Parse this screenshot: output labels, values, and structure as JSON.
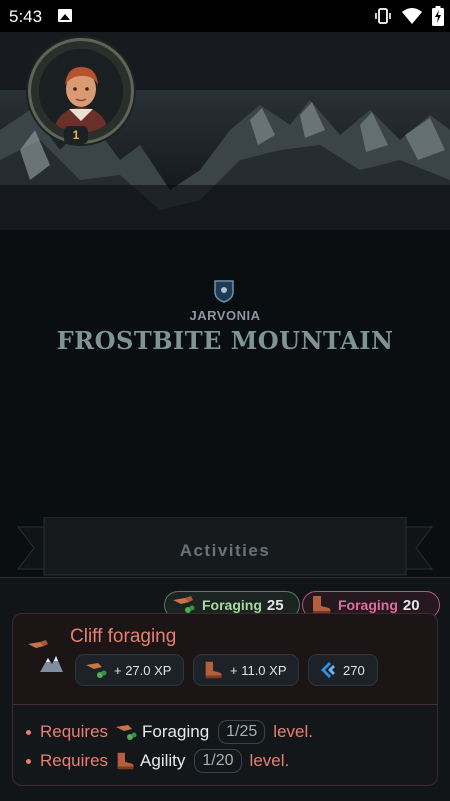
{
  "status_bar": {
    "time": "5:43",
    "icons": [
      "image-icon",
      "vibrate-icon",
      "wifi-icon",
      "battery-icon"
    ]
  },
  "player": {
    "level": "1"
  },
  "location": {
    "region": "JARVONIA",
    "name": "FROSTBITE MOUNTAIN"
  },
  "section": {
    "title": "Activities"
  },
  "skill_chips": [
    {
      "skill": "Foraging",
      "level": "25",
      "icon": "foraging-icon"
    },
    {
      "skill": "Foraging",
      "level": "20",
      "icon": "agility-boot-icon"
    }
  ],
  "activity": {
    "title": "Cliff foraging",
    "rewards": [
      {
        "label": "+ 27.0 XP",
        "icon": "foraging-icon"
      },
      {
        "label": "+ 11.0 XP",
        "icon": "agility-boot-icon"
      },
      {
        "label": "270",
        "icon": "agility-swoosh-icon"
      }
    ],
    "requirements": [
      {
        "prefix": "Requires",
        "skill": "Foraging",
        "value": "1/25",
        "suffix": "level."
      },
      {
        "prefix": "Requires",
        "skill": "Agility",
        "value": "1/20",
        "suffix": "level."
      }
    ]
  },
  "colors": {
    "accent_red": "#e87f72",
    "foraging_green": "#a9d6a4",
    "agility_pink": "#e16ca0",
    "title_teal": "#7f9595"
  }
}
